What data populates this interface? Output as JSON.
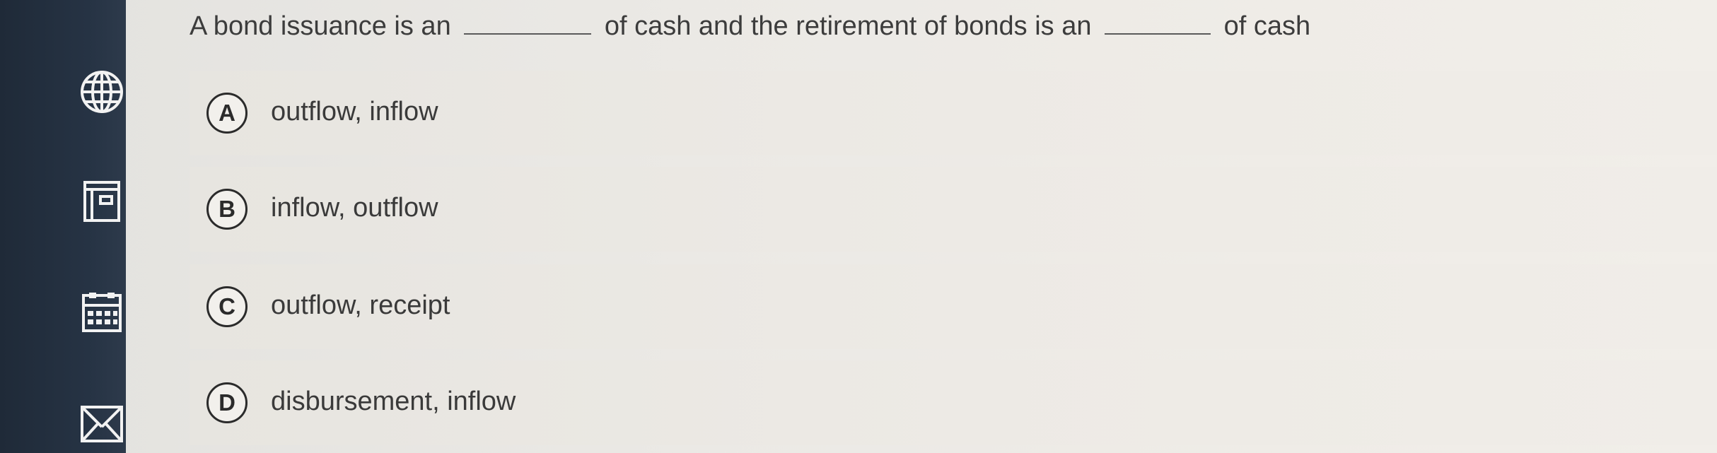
{
  "question": {
    "part1": "A bond issuance is an",
    "part2": "of cash and the retirement of bonds is an",
    "part3": "of cash"
  },
  "options": [
    {
      "letter": "A",
      "text": "outflow, inflow"
    },
    {
      "letter": "B",
      "text": "inflow, outflow"
    },
    {
      "letter": "C",
      "text": "outflow, receipt"
    },
    {
      "letter": "D",
      "text": "disbursement, inflow"
    }
  ],
  "sidebar": {
    "icons": [
      "globe-icon",
      "book-icon",
      "calendar-icon",
      "mail-icon"
    ]
  },
  "colors": {
    "sidebar": "#263344",
    "background": "#ebe9e5",
    "text": "#3c3c3c"
  }
}
